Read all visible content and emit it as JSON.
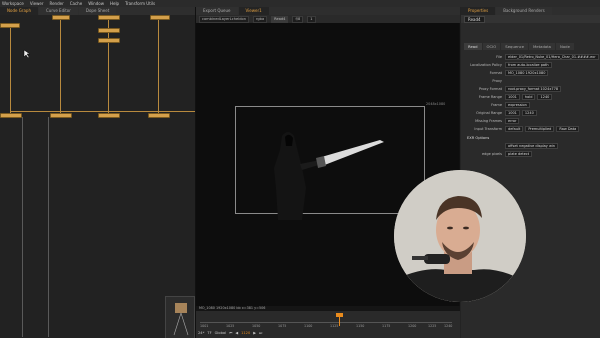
{
  "menubar": [
    "Workspace",
    "Viewer",
    "Render",
    "Cache",
    "Window",
    "Help",
    "Transform Utils"
  ],
  "nodegraph": {
    "tabs": [
      "Node Graph",
      "Curve Editor",
      "Dope Sheet"
    ],
    "accent": "#d4a04b"
  },
  "viewer": {
    "tabs": [
      "Export Queue",
      "Viewer1"
    ],
    "toolbar": {
      "input": "combinedLayerLcheldon",
      "channels": "rgba",
      "node": "Read4",
      "gain": "f/8",
      "gamma": "1"
    },
    "frame_label": "2048x1080",
    "status": "MO_1080 1920x1080  bb  x=381 y=506",
    "timeline": {
      "ticks": [
        "1001",
        "1025",
        "1050",
        "1075",
        "1100",
        "1125",
        "1150",
        "1175",
        "1200",
        "1225",
        "1240"
      ],
      "current_frame": "1120",
      "fps": "24*",
      "tf": "TF",
      "scope": "Global",
      "accent": "#e98b1d"
    }
  },
  "properties": {
    "tabs": [
      "Properties",
      "Background Renders"
    ],
    "node_name": "Read4",
    "subtabs": [
      "Read",
      "OCIO",
      "Sequence",
      "Metadata",
      "Node"
    ],
    "rows": [
      {
        "label": "File",
        "value": "elder_01/Retro_Nuke_01/Hero_Char_01.####.exr"
      },
      {
        "label": "Localization Policy",
        "value": "from auto-localize path"
      },
      {
        "label": "Format",
        "value": "MO_1080 1920x1080"
      },
      {
        "label": "Proxy",
        "value": ""
      },
      {
        "label": "Proxy Format",
        "value": "root.proxy_format 1024x778"
      },
      {
        "label": "Frame Range",
        "value": "1001",
        "value2": "hold",
        "value3": "1240"
      },
      {
        "label": "Frame",
        "value": "expression"
      },
      {
        "label": "Original Range",
        "value": "1001",
        "value2": "1240"
      },
      {
        "label": "Missing Frames",
        "value": "error"
      },
      {
        "label": "Input Transform",
        "value": "default",
        "value2": "Premultiplied",
        "value3": "Raw Data"
      }
    ],
    "exr_section": "EXR Options",
    "exr_option": "offset negative display win",
    "edge_label": "edge pixels",
    "edge_value": "plate detect"
  }
}
